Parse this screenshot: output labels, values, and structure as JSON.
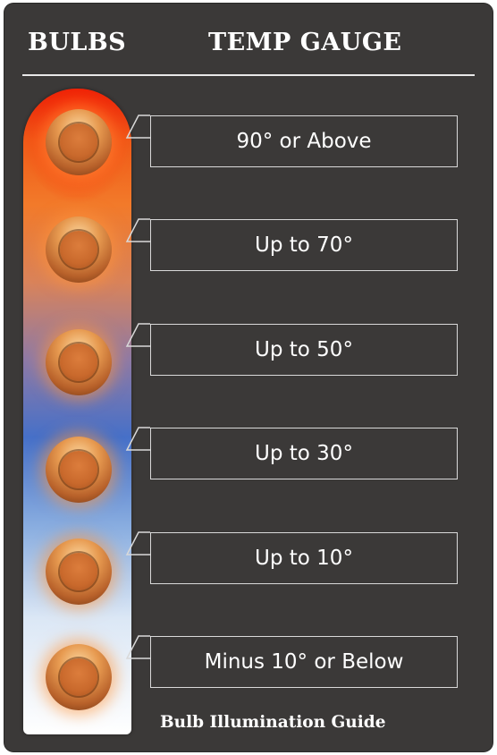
{
  "header": {
    "left_title": "BULBS",
    "right_title": "TEMP GAUGE"
  },
  "levels": [
    {
      "label": "90° or Above"
    },
    {
      "label": "Up to 70°"
    },
    {
      "label": "Up to 50°"
    },
    {
      "label": "Up to 30°"
    },
    {
      "label": "Up to 10°"
    },
    {
      "label": "Minus 10° or Below"
    }
  ],
  "footer": {
    "caption": "Bulb Illumination Guide"
  },
  "colors": {
    "panel": "#3b3938",
    "tube_top": "#e8200a",
    "tube_middle": "#4670c8",
    "tube_bottom": "#ffffff",
    "bulb": "#c9692c",
    "text": "#ffffff"
  },
  "icons": {
    "bulb": "copper-bulb-icon",
    "pointer": "callout-pointer-icon"
  }
}
